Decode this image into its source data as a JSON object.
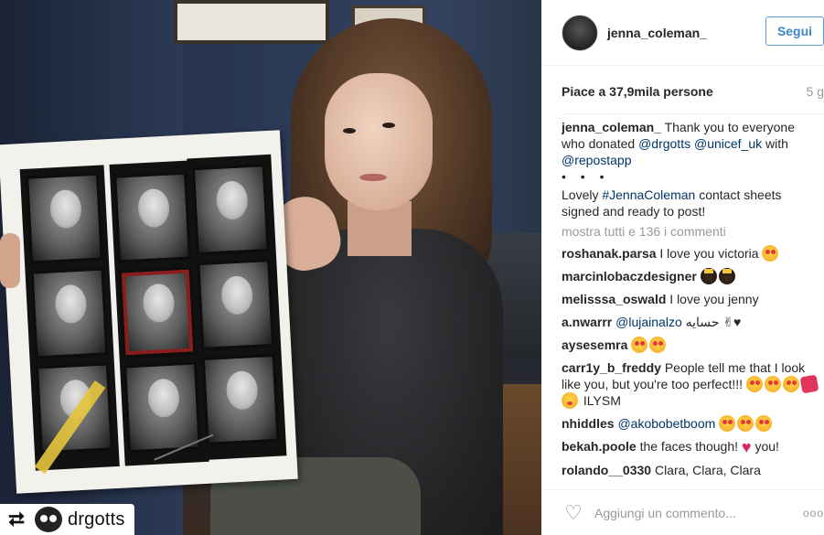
{
  "post": {
    "repost_username": "drgotts"
  },
  "header": {
    "username": "jenna_coleman_",
    "follow_label": "Segui"
  },
  "stats": {
    "likes": "Piace a 37,9mila persone",
    "age": "5 g"
  },
  "caption": {
    "username": "jenna_coleman_",
    "text_1": " Thank you to everyone who donated ",
    "tag_1": "@drgotts",
    "tag_2": "@unicef_uk",
    "text_2": " with ",
    "tag_3": "@repostapp",
    "dots": "• • •",
    "text_3": "Lovely ",
    "hashtag": "#JennaColeman",
    "text_4": " contact sheets signed and ready to post!"
  },
  "show_all": "mostra tutti e 136 i commenti",
  "comments": [
    {
      "user": "roshanak.parsa",
      "text": " I love you victoria "
    },
    {
      "user": "marcinlobaczdesigner",
      "text": " "
    },
    {
      "user": "melisssa_oswald",
      "text": " I love you jenny"
    },
    {
      "user": "a.nwarrr",
      "tag": "@lujainalzo",
      "text": " حسايه ✌♥"
    },
    {
      "user": "aysesemra",
      "text": " "
    },
    {
      "user": "carr1y_b_freddy",
      "text": " People tell me that I look like you, but you're too perfect!!! ",
      "text_end": " ILYSM"
    },
    {
      "user": "nhiddles",
      "tag": "@akobobetboom",
      "text": " "
    },
    {
      "user": "bekah.poole",
      "text": " the faces though! ",
      "text_end": " you!"
    },
    {
      "user": "rolando__0330",
      "text": " Clara, Clara, Clara"
    }
  ],
  "footer": {
    "placeholder": "Aggiungi un commento...",
    "more": "ooo"
  }
}
